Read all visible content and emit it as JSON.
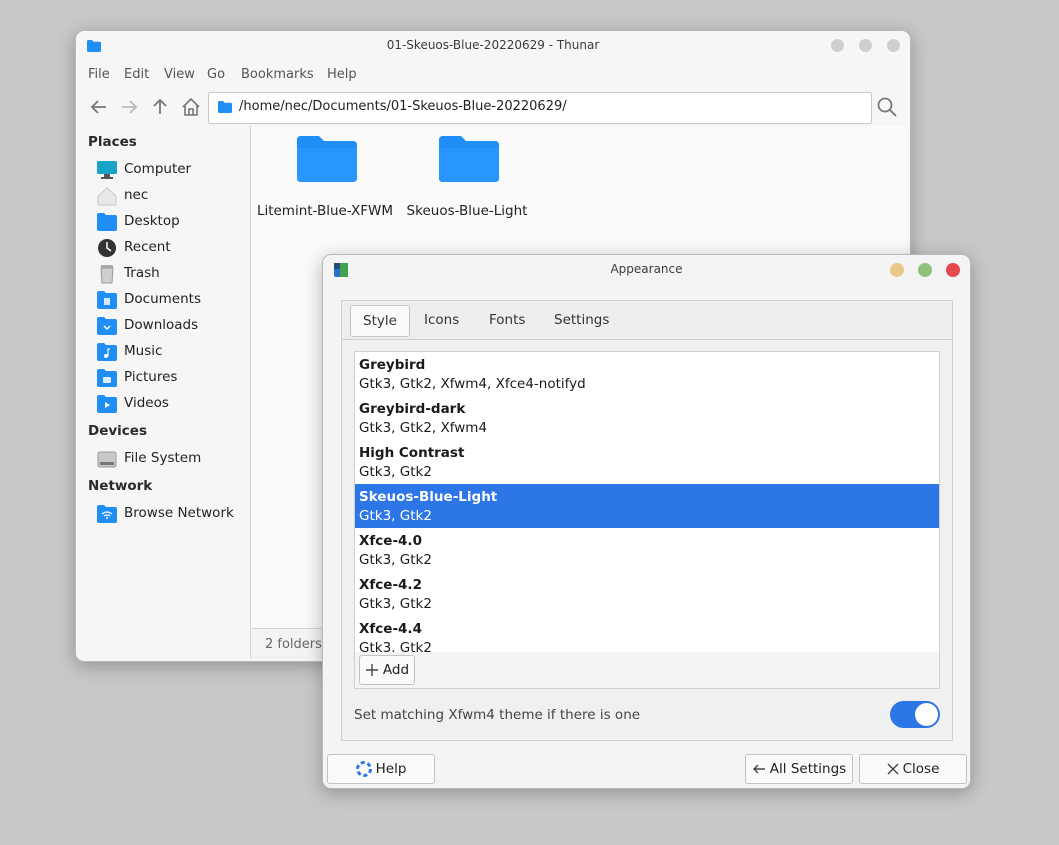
{
  "thunar": {
    "title": "01-Skeuos-Blue-20220629 - Thunar",
    "menu": [
      "File",
      "Edit",
      "View",
      "Go",
      "Bookmarks",
      "Help"
    ],
    "location": "/home/nec/Documents/01-Skeuos-Blue-20220629/",
    "sidebar": {
      "places_heading": "Places",
      "places": [
        "Computer",
        "nec",
        "Desktop",
        "Recent",
        "Trash",
        "Documents",
        "Downloads",
        "Music",
        "Pictures",
        "Videos"
      ],
      "devices_heading": "Devices",
      "devices": [
        "File System"
      ],
      "network_heading": "Network",
      "network": [
        "Browse Network"
      ]
    },
    "folders": [
      "Litemint-Blue-XFWM",
      "Skeuos-Blue-Light"
    ],
    "status": "2 folders"
  },
  "appearance": {
    "title": "Appearance",
    "tabs": [
      "Style",
      "Icons",
      "Fonts",
      "Settings"
    ],
    "themes": [
      {
        "name": "Greybird",
        "support": "Gtk3, Gtk2, Xfwm4, Xfce4-notifyd"
      },
      {
        "name": "Greybird-dark",
        "support": "Gtk3, Gtk2, Xfwm4"
      },
      {
        "name": "High Contrast",
        "support": "Gtk3, Gtk2"
      },
      {
        "name": "Skeuos-Blue-Light",
        "support": "Gtk3, Gtk2"
      },
      {
        "name": "Xfce-4.0",
        "support": "Gtk3, Gtk2"
      },
      {
        "name": "Xfce-4.2",
        "support": "Gtk3, Gtk2"
      },
      {
        "name": "Xfce-4.4",
        "support": "Gtk3, Gtk2"
      }
    ],
    "selected_theme": "Skeuos-Blue-Light",
    "add_label": "Add",
    "matching_label": "Set matching Xfwm4 theme if there is one",
    "matching_enabled": true,
    "help_label": "Help",
    "all_settings_label": "All Settings",
    "close_label": "Close"
  },
  "colors": {
    "accent": "#2d76e8",
    "folder": "#1f8ef5",
    "close_red": "#e5484d",
    "minimize_yellow": "#e9c88a",
    "maximize_green": "#8fc27c"
  }
}
